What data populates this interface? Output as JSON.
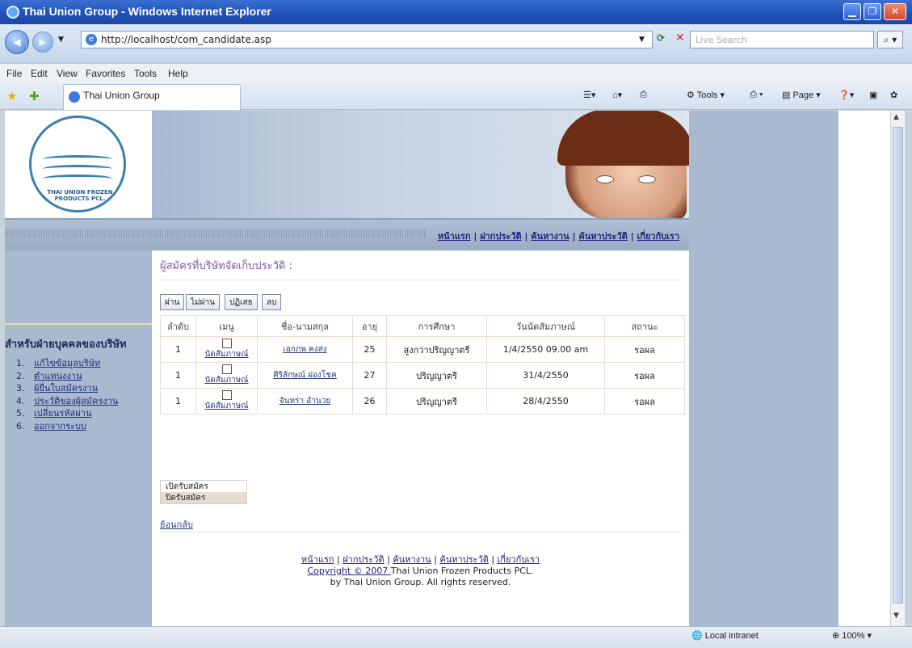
{
  "window": {
    "title": "Thai Union Group - Windows Internet Explorer"
  },
  "address": {
    "url": "http://localhost/com_candidate.asp",
    "search_placeholder": "Live Search"
  },
  "menu": [
    "File",
    "Edit",
    "View",
    "Favorites",
    "Tools",
    "Help"
  ],
  "tab": {
    "label": "Thai Union Group"
  },
  "toolbar_right": {
    "home": "",
    "tools_label": "Tools",
    "page_label": "Page"
  },
  "site": {
    "logo_text": "THAI UNION FROZEN PRODUCTS PCL.",
    "nav_links": [
      "หน้าแรก",
      "ฝากประวัติ",
      "ค้นหางาน",
      "ค้นหาประวัติ",
      "เกี่ยวกับเรา"
    ]
  },
  "sidebar": {
    "title": "สำหรับฝ่ายบุคคลของบริษัท",
    "items": [
      {
        "num": "1.",
        "label": "แก้ไขข้อมูลบริษัท"
      },
      {
        "num": "2.",
        "label": "ตำแหน่งงาน"
      },
      {
        "num": "3.",
        "label": "ผู้ยื่นใบสมัครงาน"
      },
      {
        "num": "4.",
        "label": "ประวัติของผู้สมัครงาน"
      },
      {
        "num": "5.",
        "label": "เปลี่ยนรหัสผ่าน"
      },
      {
        "num": "6.",
        "label": "ออกจากระบบ"
      }
    ]
  },
  "content": {
    "title": "ผู้สมัครที่บริษัทจัดเก็บประวัติ :",
    "actions": [
      "ผ่าน",
      "ไม่ผ่าน",
      "ปฏิเสธ",
      "ลบ"
    ],
    "columns": [
      "ลำดับ",
      "เมนู",
      "ชื่อ-นามสกุล",
      "อายุ",
      "การศึกษา",
      "วันนัดสัมภาษณ์",
      "สถานะ"
    ],
    "rows": [
      {
        "no": "1",
        "menu": "นัดสัมภาษณ์",
        "name": "เอกภพ คงสง",
        "age": "25",
        "education": "สูงกว่าปริญญาตรี",
        "date": "1/4/2550 09.00 am",
        "status": "รอผล"
      },
      {
        "no": "1",
        "menu": "นัดสัมภาษณ์",
        "name": "ศิริลักษณ์ ผ่องโชค",
        "age": "27",
        "education": "ปริญญาตรี",
        "date": "31/4/2550",
        "status": "รอผล"
      },
      {
        "no": "1",
        "menu": "นัดสัมภาษณ์",
        "name": "จันทรา อำนวย",
        "age": "26",
        "education": "ปริญญาตรี",
        "date": "28/4/2550",
        "status": "รอผล"
      }
    ],
    "open_label": "เปิดรับสมัคร",
    "close_label": "ปิดรับสมัคร",
    "back_label": "ย้อนกลับ"
  },
  "footer": {
    "links": [
      "หน้าแรก",
      "ฝากประวัติ",
      "ค้นหางาน",
      "ค้นหาประวัติ",
      "เกี่ยวกับเรา"
    ],
    "copyright_link": "Copyright © 2007 ",
    "copyright_text": "Thai Union Frozen Products PCL.",
    "rights": "by Thai Union Group. All rights reserved."
  },
  "status": {
    "zone": "Local intranet",
    "zoom": "100%"
  },
  "colors": {
    "titlebar": "#2153b7",
    "sidebar": "#a9b9cf",
    "link": "#22237a"
  }
}
